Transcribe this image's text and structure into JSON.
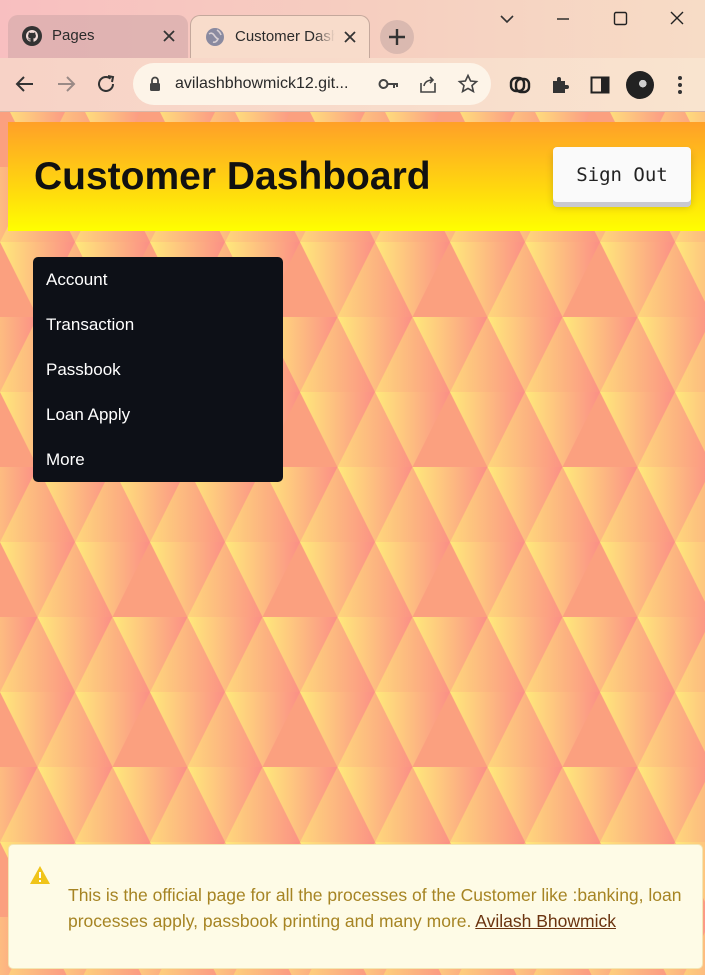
{
  "browser": {
    "tabs": [
      {
        "title": "Pages",
        "favicon": "github-icon",
        "active": false
      },
      {
        "title": "Customer Dashboard",
        "favicon": "globe-icon",
        "active": true
      }
    ],
    "url": "avilashbhowmick12.git...",
    "profile": "avatar"
  },
  "page": {
    "title": "Customer Dashboard",
    "sign_out_label": "Sign Out",
    "nav_items": [
      "Account",
      "Transaction",
      "Passbook",
      "Loan Apply",
      "More"
    ],
    "alert": {
      "icon": "warning-icon",
      "text": "This is the official page for all the processes of the Customer like :banking, loan processes apply, passbook printing and many more.",
      "link_text": "Avilash Bhowmick"
    }
  },
  "colors": {
    "header_top": "#ffa028",
    "header_bottom": "#ffff00",
    "nav_background": "#0d1017",
    "alert_background": "#fefbe6",
    "alert_text": "#a68423",
    "pattern_coral": "#fb8f86",
    "pattern_yellow": "#ffe97b"
  }
}
